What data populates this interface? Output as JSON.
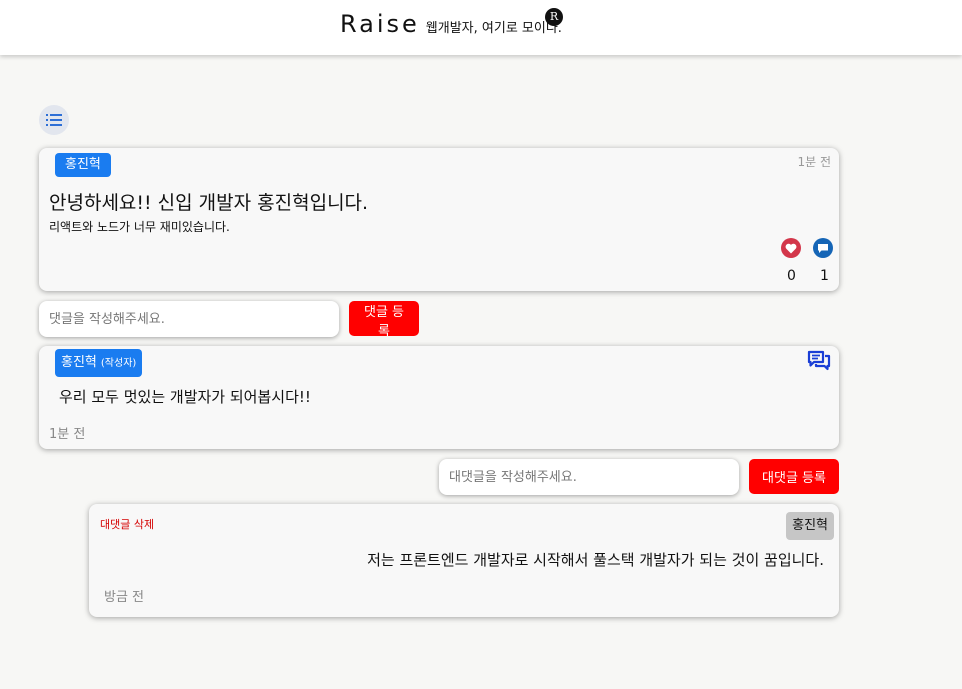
{
  "header": {
    "brand_name": "Raise",
    "tagline": "웹개발자, 여기로 모이다.",
    "badge": "R"
  },
  "list_button": {
    "icon": "list-icon"
  },
  "post": {
    "author": "홍진혁",
    "time": "1분 전",
    "title": "안녕하세요!! 신입 개발자 홍진혁입니다.",
    "body": "리액트와 노드가 너무 재미있습니다.",
    "like_count": "0",
    "comment_count": "1",
    "colors": {
      "like": "#d3364a",
      "comment": "#1565b6",
      "author_chip": "#1a7cf0"
    }
  },
  "comment_form": {
    "placeholder": "댓글을 작성해주세요.",
    "submit_label": "댓글 등록"
  },
  "comment": {
    "author": "홍진혁",
    "writer_tag": "(작성자)",
    "text": "우리 모두 멋있는 개발자가 되어봅시다!!",
    "time": "1분 전",
    "reply_icon": "chat-bubbles-icon"
  },
  "reply_form": {
    "placeholder": "대댓글을 작성해주세요.",
    "submit_label": "대댓글 등록"
  },
  "reply": {
    "delete_label": "대댓글 삭제",
    "author": "홍진혁",
    "text": "저는 프론트엔드 개발자로 시작해서 풀스택 개발자가 되는 것이 꿈입니다.",
    "time": "방금 전"
  },
  "accent_colors": {
    "primary_button": "#ff0000",
    "delete_text": "#d40000"
  }
}
